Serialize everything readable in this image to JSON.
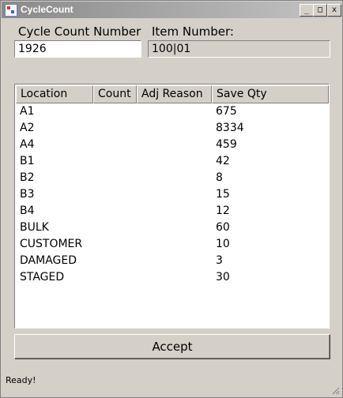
{
  "window": {
    "title": "CycleCount",
    "btn_minimize": "_",
    "btn_maximize": "□",
    "btn_close": "x"
  },
  "form": {
    "cycle_count_label": "Cycle Count Number",
    "item_number_label": "Item Number:",
    "cycle_count_value": "1926",
    "item_number_value": "100|01"
  },
  "table": {
    "columns": [
      "Location",
      "Count",
      "Adj Reason",
      "Save Qty"
    ],
    "rows": [
      {
        "location": "A1",
        "count": "",
        "adj_reason": "",
        "save_qty": "675"
      },
      {
        "location": "A2",
        "count": "",
        "adj_reason": "",
        "save_qty": "8334"
      },
      {
        "location": "A4",
        "count": "",
        "adj_reason": "",
        "save_qty": "459"
      },
      {
        "location": "B1",
        "count": "",
        "adj_reason": "",
        "save_qty": "42"
      },
      {
        "location": "B2",
        "count": "",
        "adj_reason": "",
        "save_qty": "8"
      },
      {
        "location": "B3",
        "count": "",
        "adj_reason": "",
        "save_qty": "15"
      },
      {
        "location": "B4",
        "count": "",
        "adj_reason": "",
        "save_qty": "12"
      },
      {
        "location": "BULK",
        "count": "",
        "adj_reason": "",
        "save_qty": "60"
      },
      {
        "location": "CUSTOMER",
        "count": "",
        "adj_reason": "",
        "save_qty": "10"
      },
      {
        "location": "DAMAGED",
        "count": "",
        "adj_reason": "",
        "save_qty": "3"
      },
      {
        "location": "STAGED",
        "count": "",
        "adj_reason": "",
        "save_qty": "30"
      }
    ]
  },
  "actions": {
    "accept_label": "Accept"
  },
  "status": {
    "text": "Ready!"
  }
}
